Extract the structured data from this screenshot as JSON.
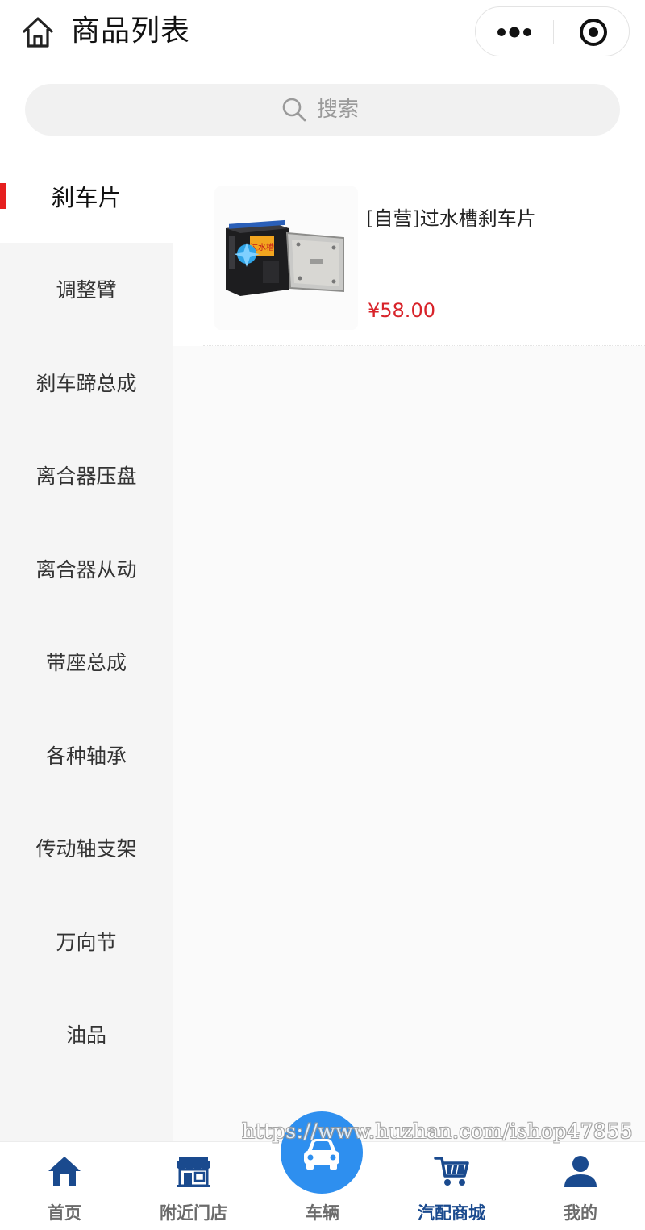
{
  "header": {
    "title": "商品列表",
    "home_icon": "home-icon",
    "more_icon": "more-dots-icon",
    "close_icon": "target-circle-icon"
  },
  "search": {
    "placeholder": "搜索",
    "icon": "search-icon"
  },
  "sidebar": {
    "items": [
      {
        "label": "刹车片",
        "active": true
      },
      {
        "label": "调整臂",
        "active": false
      },
      {
        "label": "刹车蹄总成",
        "active": false
      },
      {
        "label": "离合器压盘",
        "active": false
      },
      {
        "label": "离合器从动",
        "active": false
      },
      {
        "label": "带座总成",
        "active": false
      },
      {
        "label": "各种轴承",
        "active": false
      },
      {
        "label": "传动轴支架",
        "active": false
      },
      {
        "label": "万向节",
        "active": false
      },
      {
        "label": "油品",
        "active": false
      }
    ]
  },
  "products": [
    {
      "name": "[自营]过水槽刹车片",
      "price": "¥58.00",
      "image_icon": "brake-pad-product-image",
      "package_text": "过水槽"
    }
  ],
  "watermark": "https://www.huzhan.com/ishop47855",
  "tabbar": {
    "items": [
      {
        "label": "首页",
        "icon": "home-icon",
        "active": false
      },
      {
        "label": "附近门店",
        "icon": "store-icon",
        "active": false
      },
      {
        "label": "车辆",
        "icon": "car-icon",
        "active": false
      },
      {
        "label": "汽配商城",
        "icon": "cart-icon",
        "active": true
      },
      {
        "label": "我的",
        "icon": "user-icon",
        "active": false
      }
    ]
  },
  "colors": {
    "accent_red": "#e61f1f",
    "price_red": "#d8232a",
    "tab_active": "#1a4a8e",
    "tab_icon_blue": "#1a4a8e",
    "center_button_blue": "#2e8fef",
    "sidebar_bg": "#f5f5f5"
  }
}
